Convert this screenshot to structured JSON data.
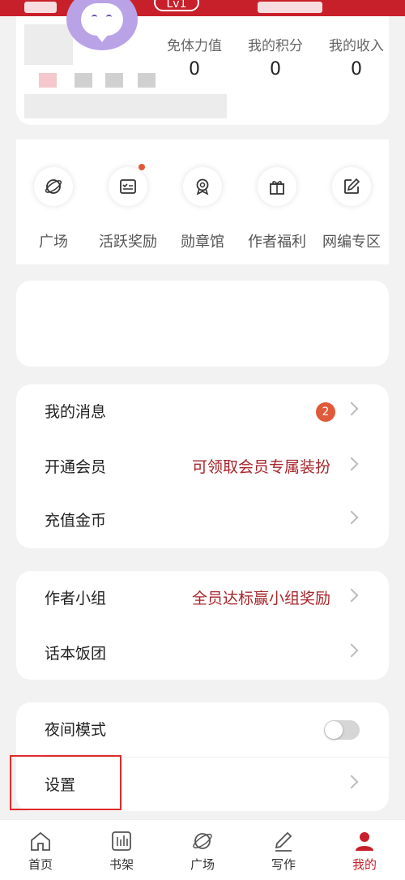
{
  "header": {
    "level_badge": "Lv1"
  },
  "profile": {
    "stats": [
      {
        "label": "免体力值",
        "value": "0"
      },
      {
        "label": "我的积分",
        "value": "0"
      },
      {
        "label": "我的收入",
        "value": "0"
      }
    ]
  },
  "shortcuts": [
    {
      "label": "广场",
      "icon": "planet-icon",
      "dot": false
    },
    {
      "label": "活跃奖励",
      "icon": "checklist-icon",
      "dot": true
    },
    {
      "label": "勋章馆",
      "icon": "medal-icon",
      "dot": false
    },
    {
      "label": "作者福利",
      "icon": "gift-icon",
      "dot": false
    },
    {
      "label": "网编专区",
      "icon": "edit-icon",
      "dot": false
    }
  ],
  "menu1": {
    "messages": {
      "label": "我的消息",
      "badge": "2"
    },
    "vip": {
      "label": "开通会员",
      "value": "可领取会员专属装扮"
    },
    "recharge": {
      "label": "充值金币"
    }
  },
  "menu2": {
    "author_group": {
      "label": "作者小组",
      "value": "全员达标赢小组奖励"
    },
    "fan_group": {
      "label": "话本饭团"
    }
  },
  "menu3": {
    "night_mode": {
      "label": "夜间模式",
      "enabled": false
    },
    "settings": {
      "label": "设置"
    }
  },
  "tabbar": [
    {
      "label": "首页",
      "icon": "home-icon",
      "active": false
    },
    {
      "label": "书架",
      "icon": "bookshelf-icon",
      "active": false
    },
    {
      "label": "广场",
      "icon": "planet-icon",
      "active": false
    },
    {
      "label": "写作",
      "icon": "pen-icon",
      "active": false
    },
    {
      "label": "我的",
      "icon": "user-icon",
      "active": true
    }
  ],
  "colors": {
    "brand_red": "#c8202a",
    "accent_text": "#a8252b",
    "badge": "#e05a3a"
  }
}
